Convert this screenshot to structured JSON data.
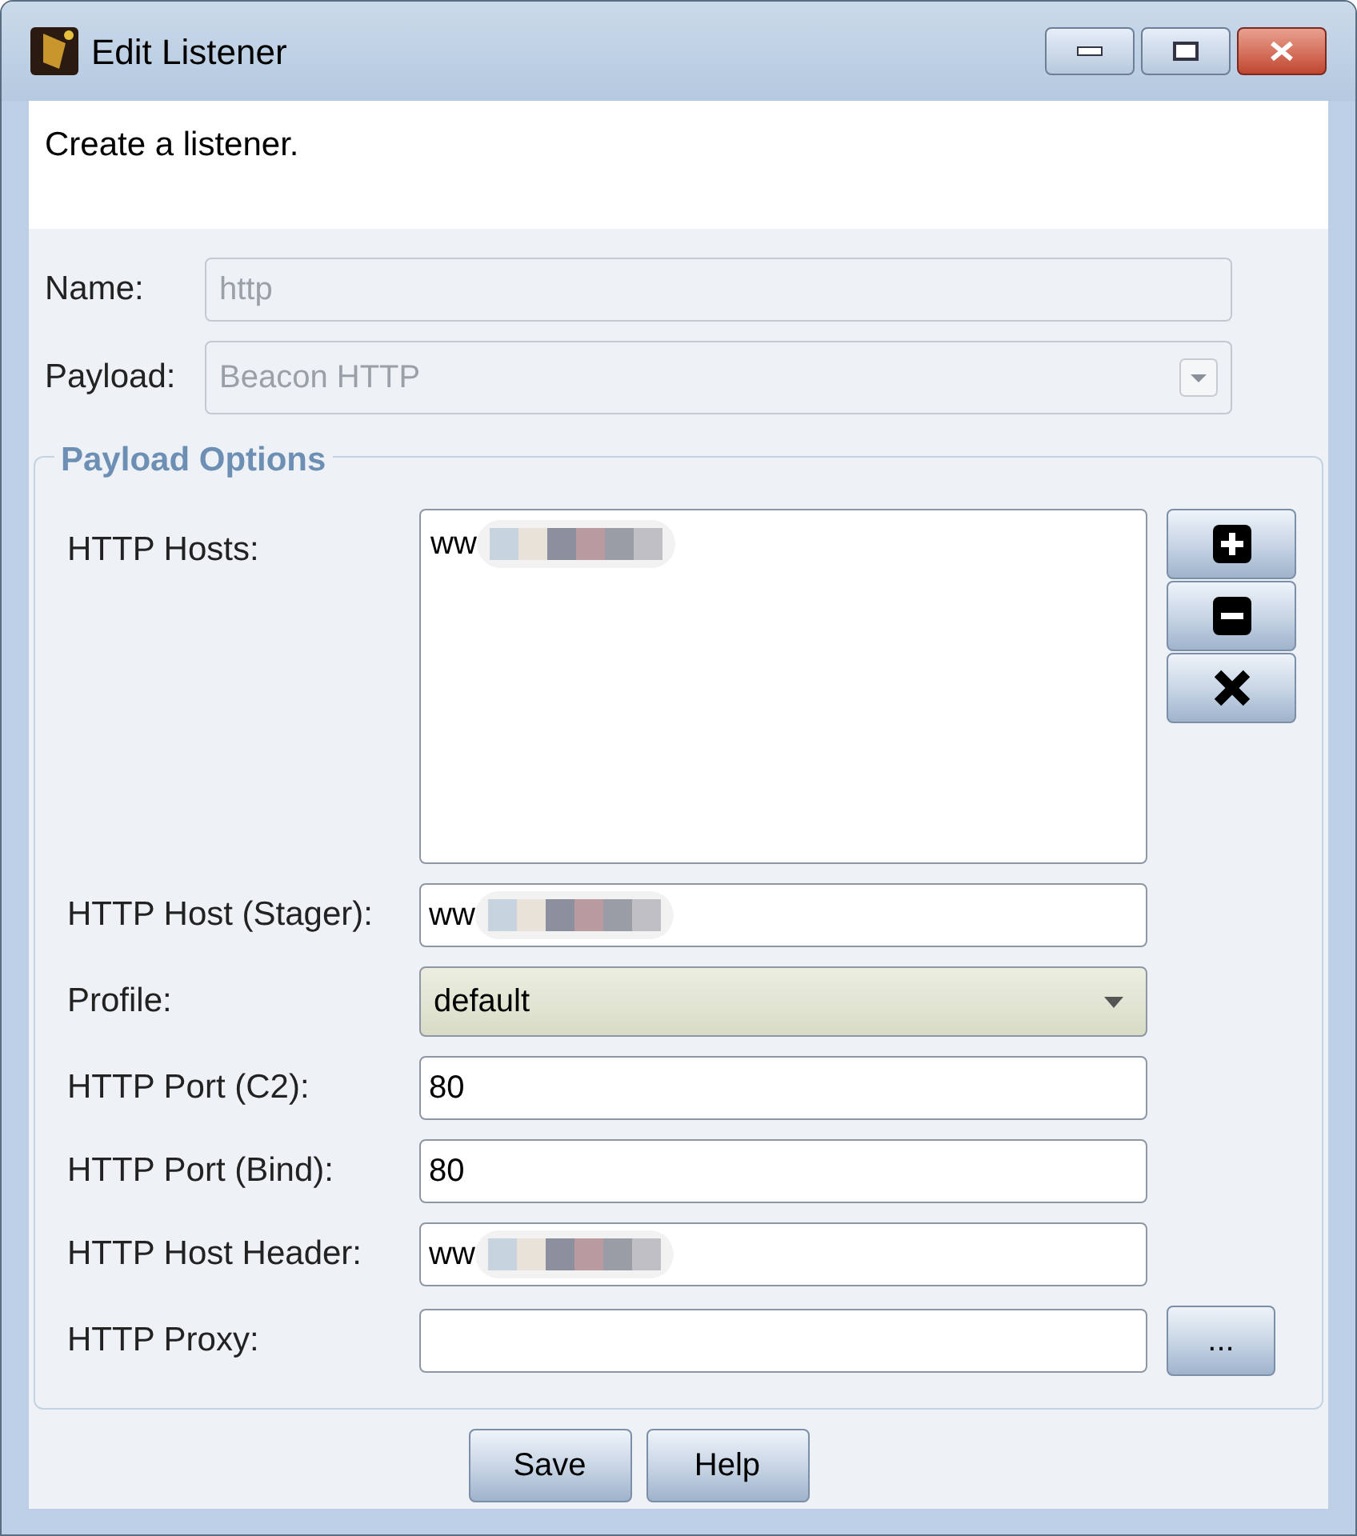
{
  "window": {
    "title": "Edit Listener"
  },
  "description": "Create a listener.",
  "name_field": {
    "label": "Name:",
    "value": "http",
    "disabled": true
  },
  "payload_field": {
    "label": "Payload:",
    "value": "Beacon HTTP",
    "disabled": true
  },
  "payload_options": {
    "title": "Payload Options",
    "hosts": {
      "label": "HTTP Hosts:",
      "items": [
        "ww"
      ]
    },
    "host_buttons": [
      {
        "kind": "add"
      },
      {
        "kind": "remove"
      },
      {
        "kind": "clear"
      }
    ],
    "fields": [
      {
        "kind": "text",
        "label": "HTTP Host (Stager):",
        "value": "ww",
        "redacted": true
      },
      {
        "kind": "combo",
        "label": "Profile:",
        "value": "default"
      },
      {
        "kind": "text",
        "label": "HTTP Port (C2):",
        "value": "80",
        "redacted": false
      },
      {
        "kind": "text",
        "label": "HTTP Port (Bind):",
        "value": "80",
        "redacted": false
      },
      {
        "kind": "text",
        "label": "HTTP Host Header:",
        "value": "ww",
        "redacted": true
      },
      {
        "kind": "browse",
        "label": "HTTP Proxy:",
        "button": "..."
      }
    ]
  },
  "buttons": [
    "Save",
    "Help"
  ]
}
